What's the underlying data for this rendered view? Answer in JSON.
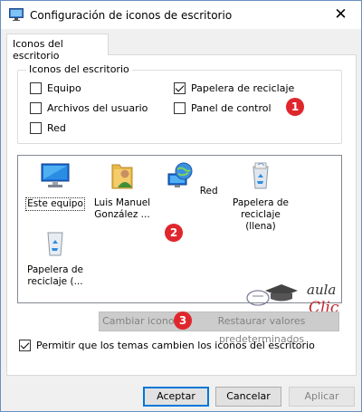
{
  "window": {
    "title": "Configuración de iconos de escritorio",
    "close": "✕"
  },
  "tab": {
    "label": "Iconos del escritorio"
  },
  "group": {
    "title": "Iconos del escritorio",
    "checkboxes": [
      {
        "label": "Equipo",
        "checked": false
      },
      {
        "label": "Papelera de reciclaje",
        "checked": true
      },
      {
        "label": "Archivos del usuario",
        "checked": false
      },
      {
        "label": "Panel de control",
        "checked": false
      },
      {
        "label": "Red",
        "checked": false
      }
    ]
  },
  "icons": [
    {
      "line1": "Este equipo",
      "line2": "",
      "icon": "monitor-icon"
    },
    {
      "line1": "Luis Manuel",
      "line2": "González ...",
      "icon": "user-folder-icon"
    },
    {
      "line1": "Red",
      "line2": "",
      "icon": "network-globe-icon"
    },
    {
      "line1": "Papelera de",
      "line2": "reciclaje (llena)",
      "icon": "recycle-bin-full-icon"
    },
    {
      "line1": "Papelera de",
      "line2": "reciclaje (...",
      "icon": "recycle-bin-empty-icon"
    }
  ],
  "buttons": {
    "change_icon": "Cambiar icono...",
    "restore": "Restaurar valores predeterminados",
    "accept": "Aceptar",
    "cancel": "Cancelar",
    "apply": "Aplicar"
  },
  "themes_checkbox": {
    "label": "Permitir que los temas cambien los iconos del escritorio",
    "checked": true
  },
  "badges": [
    "1",
    "2",
    "3"
  ],
  "watermark": {
    "line1": "aula",
    "line2": "Clic"
  },
  "colors": {
    "badge": "#e0262d",
    "accent": "#0078d7",
    "logo_red": "#c0272d"
  }
}
